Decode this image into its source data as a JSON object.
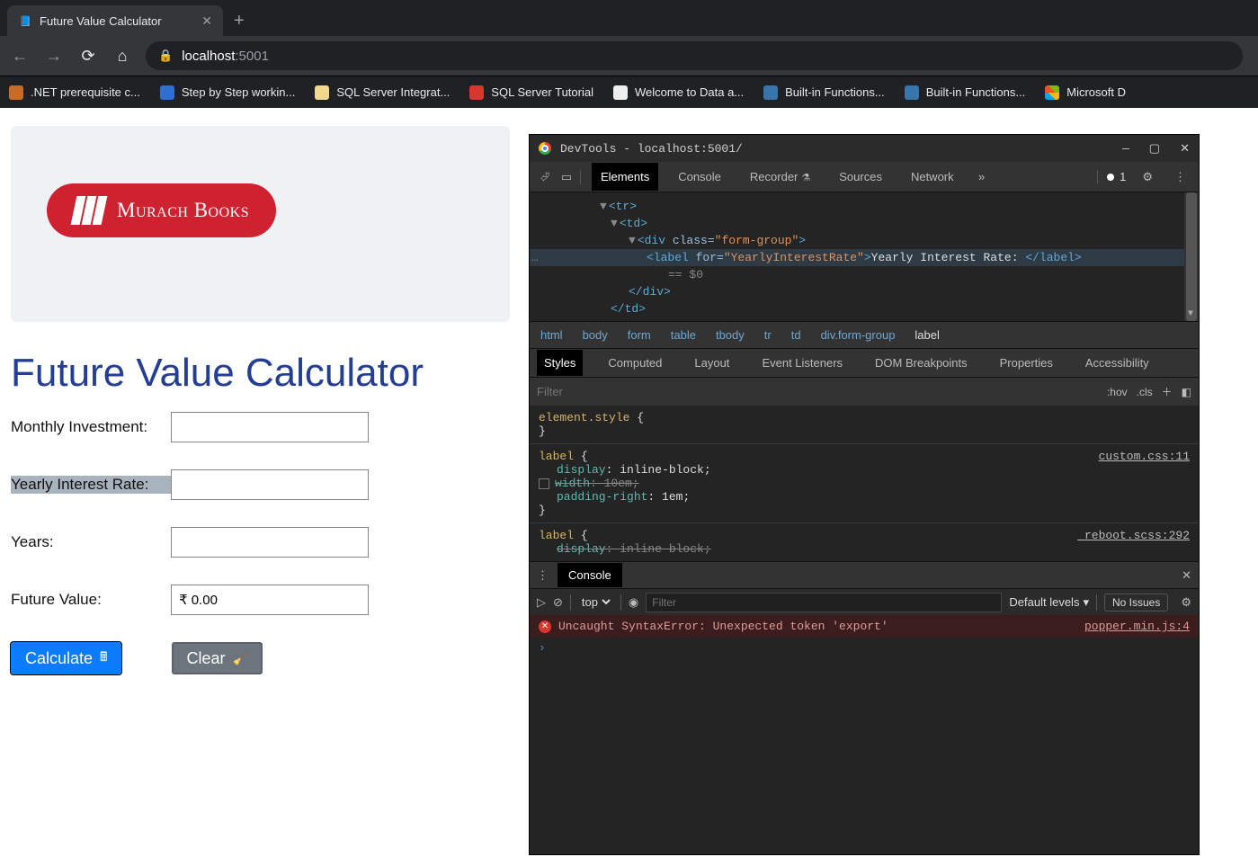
{
  "browser": {
    "tab_title": "Future Value Calculator",
    "url_host": "localhost",
    "url_port": ":5001",
    "bookmarks": [
      {
        "label": ".NET prerequisite c...",
        "color": "#c96b24"
      },
      {
        "label": "Step by Step workin...",
        "color": "#2f6fd4"
      },
      {
        "label": "SQL Server Integrat...",
        "color": "#f2d88c"
      },
      {
        "label": "SQL Server Tutorial",
        "color": "#d9362e"
      },
      {
        "label": "Welcome to Data a...",
        "color": "#eee"
      },
      {
        "label": "Built-in Functions...",
        "color": "#3776ab"
      },
      {
        "label": "Built-in Functions...",
        "color": "#3776ab"
      },
      {
        "label": "Microsoft D",
        "color": "windows"
      }
    ]
  },
  "page": {
    "logo_text": "Murach Books",
    "heading": "Future Value Calculator",
    "labels": {
      "monthly": "Monthly Investment:",
      "rate": "Yearly Interest Rate:",
      "years": "Years:",
      "future": "Future Value:"
    },
    "future_value": "₹ 0.00",
    "btn_calc": "Calculate",
    "btn_clear": "Clear"
  },
  "devtools": {
    "title": "DevTools - localhost:5001/",
    "tabs": [
      "Elements",
      "Console",
      "Recorder",
      "Sources",
      "Network"
    ],
    "badge_count": "1",
    "dom": {
      "tr": "<tr>",
      "td_open": "<td>",
      "div_open": "<div class=\"form-group\">",
      "label_open_tag": "<label ",
      "label_for_attr": "for=",
      "label_for_val": "\"YearlyInterestRate\"",
      "label_text": "Yearly Interest Rate: ",
      "label_close": "</label>",
      "eq0": "== $0",
      "div_close": "</div>",
      "td_close": "</td>"
    },
    "crumbs": [
      "html",
      "body",
      "form",
      "table",
      "tbody",
      "tr",
      "td",
      "div.form-group",
      "label"
    ],
    "style_tabs": [
      "Styles",
      "Computed",
      "Layout",
      "Event Listeners",
      "DOM Breakpoints",
      "Properties",
      "Accessibility"
    ],
    "filter_placeholder": "Filter",
    "hov": ":hov",
    "cls": ".cls",
    "css1_src": "custom.css:11",
    "css2_src": "_reboot.scss:292",
    "element_style": "element.style",
    "label_sel": "label",
    "p_display": "display",
    "v_display": "inline-block",
    "p_width": "width",
    "v_width": "10em",
    "p_padr": "padding-right",
    "v_padr": "1em",
    "cut_display": "display",
    "cut_display_v": "inline block",
    "console_tab": "Console",
    "top": "top",
    "console_filter": "Filter",
    "levels": "Default levels",
    "noissues": "No Issues",
    "error": "Uncaught SyntaxError: Unexpected token 'export'",
    "error_src": "popper.min.js:4"
  }
}
